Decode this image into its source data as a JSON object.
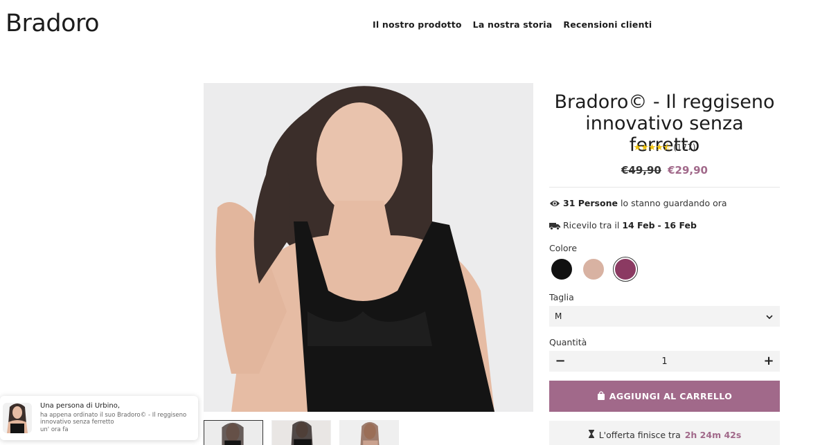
{
  "header": {
    "logo": "Bradoro",
    "nav": [
      "Il nostro prodotto",
      "La nostra storia",
      "Recensioni clienti"
    ]
  },
  "product": {
    "title": "Bradoro© - Il reggiseno innovativo senza ferretto",
    "rating_stars": 4.5,
    "rating_count": "(177)",
    "price_old": "€49,90",
    "price_new": "€29,90",
    "viewers_count": "31 Persone",
    "viewers_text": "lo stanno guardando ora",
    "delivery_prefix": "Ricevilo tra il",
    "delivery_from": "14 Feb",
    "delivery_sep": "-",
    "delivery_to": "16 Feb",
    "color_label": "Colore",
    "colors": [
      "#111111",
      "#d8b2a2",
      "#8b3a62"
    ],
    "selected_color": 2,
    "size_label": "Taglia",
    "size_value": "M",
    "quantity_label": "Quantità",
    "quantity_value": "1",
    "add_to_cart": "AGGIUNGI AL CARRELLO",
    "offer_prefix": "L'offerta finisce tra",
    "offer_time": "2h 24m 42s"
  },
  "toast": {
    "line1": "Una persona di Urbino,",
    "line2": "ha appena ordinato il suo Bradoro© - Il reggiseno innovativo senza ferretto",
    "line3": "un' ora fa"
  },
  "colors": {
    "accent": "#a1698a",
    "field_bg": "#f3f3f3"
  }
}
